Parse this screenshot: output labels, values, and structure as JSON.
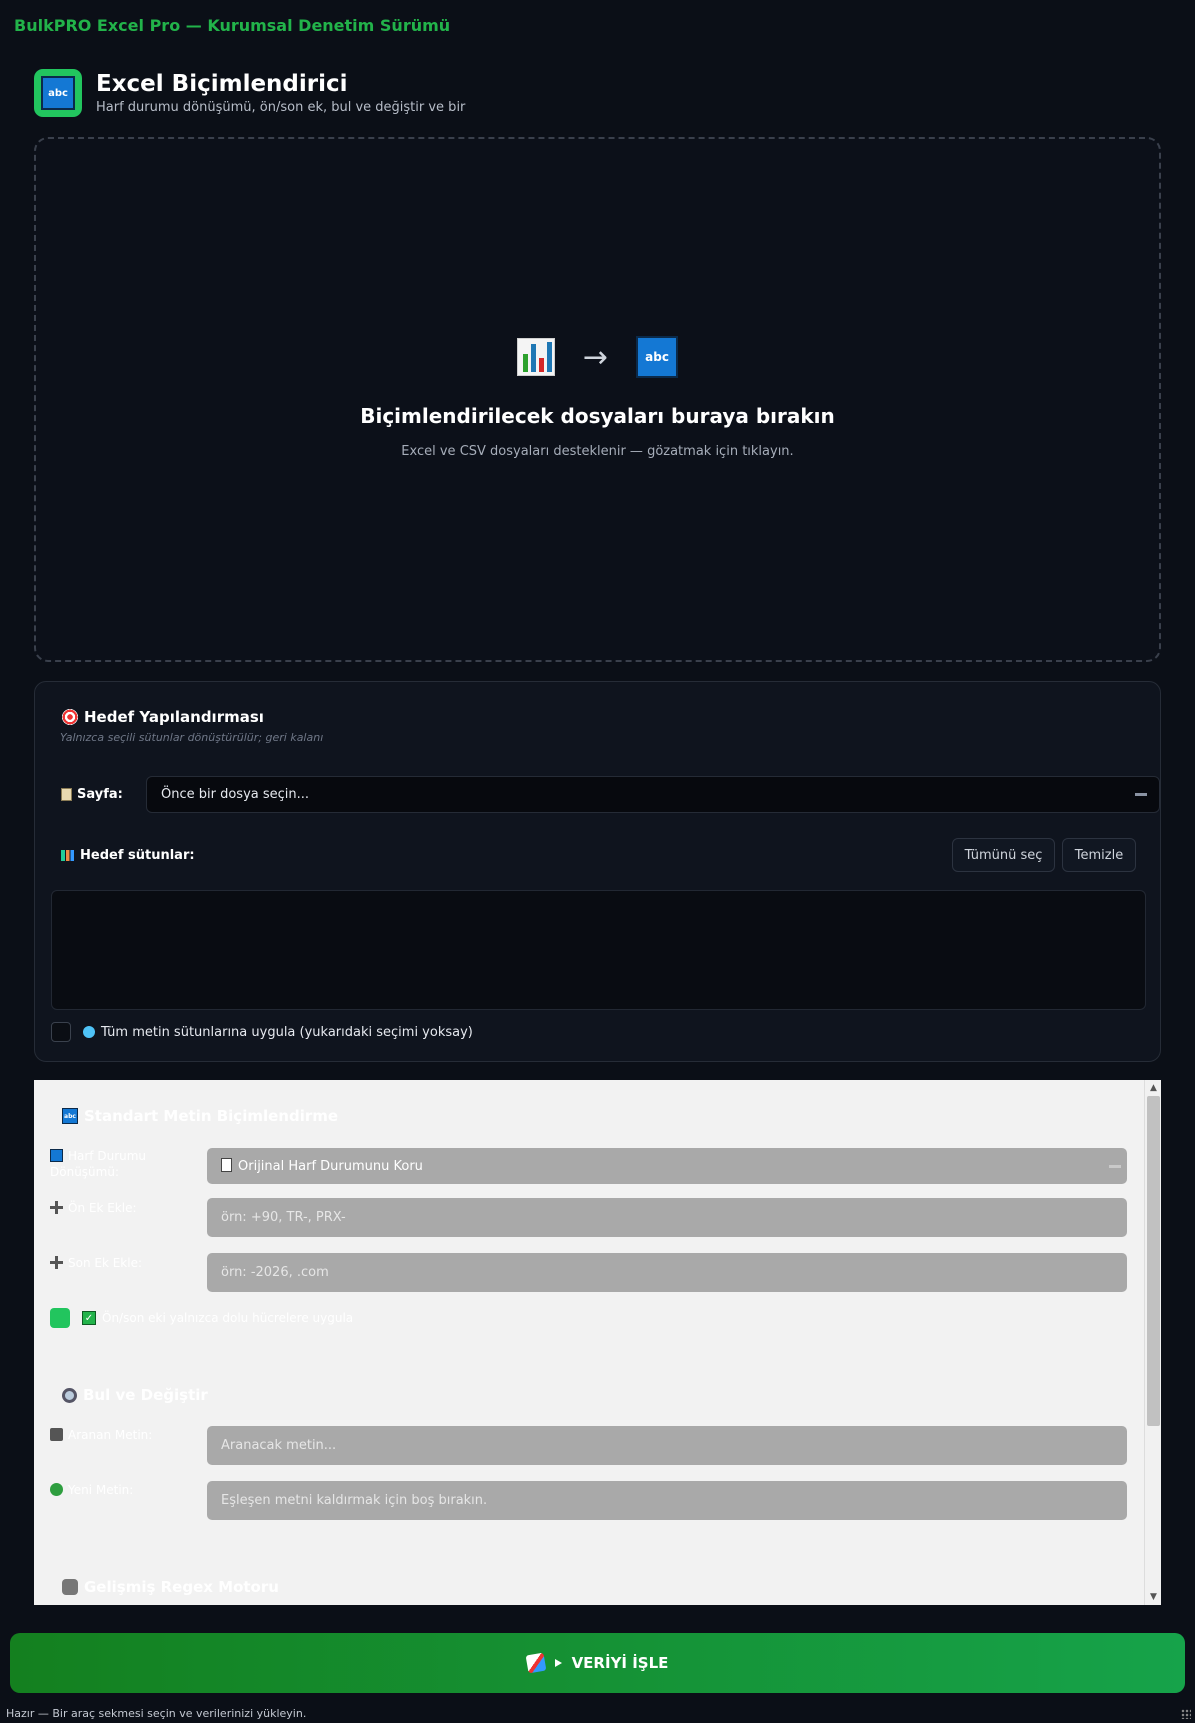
{
  "app": {
    "title": "BulkPRO Excel Pro — Kurumsal Denetim Sürümü"
  },
  "header": {
    "title": "Excel Biçimlendirici",
    "subtitle": "Harf durumu dönüşümü, ön/son ek, bul ve değiştir ve bir",
    "logo_text": "abc"
  },
  "dropzone": {
    "title": "Biçimlendirilecek dosyaları buraya bırakın",
    "subtitle": "Excel ve CSV dosyaları desteklenir — gözatmak için tıklayın.",
    "icon_left": "chart-icon",
    "arrow": "→",
    "icon_right_text": "abc"
  },
  "target": {
    "title": "Hedef Yapılandırması",
    "subtitle": "Yalnızca seçili sütunlar dönüştürülür; geri kalanı",
    "sheet_label": "Sayfa:",
    "sheet_value": "Önce bir dosya seçin...",
    "columns_label": "Hedef sütunlar:",
    "select_all_label": "Tümünü seç",
    "clear_label": "Temizle",
    "apply_all_label": "Tüm metin sütunlarına uygula (yukarıdaki seçimi yoksay)"
  },
  "formatting": {
    "standard_title": "Standart Metin Biçimlendirme",
    "standard_icon_text": "abc",
    "case_label": "Harf Durumu Dönüşümü:",
    "case_value": "Orijinal Harf Durumunu Koru",
    "prefix_label": "Ön Ek Ekle:",
    "prefix_placeholder": "örn: +90, TR-, PRX-",
    "suffix_label": "Son Ek Ekle:",
    "suffix_placeholder": "örn: -2026, .com",
    "only_filled_label": "Ön/son eki yalnızca dolu hücrelere uygula",
    "find_title": "Bul ve Değiştir",
    "search_label": "Aranan Metin:",
    "search_placeholder": "Aranacak metin...",
    "replace_label": "Yeni Metin:",
    "replace_placeholder": "Eşleşen metni kaldırmak için boş bırakın.",
    "regex_title": "Gelişmiş Regex Motoru"
  },
  "actions": {
    "process_label": "VERİYİ İŞLE"
  },
  "status": {
    "text": "Hazır — Bir araç sekmesi seçin ve verilerinizi yükleyin."
  },
  "colors": {
    "accent": "#22b34a",
    "button": "#16a34a",
    "background": "#0b0f17"
  }
}
